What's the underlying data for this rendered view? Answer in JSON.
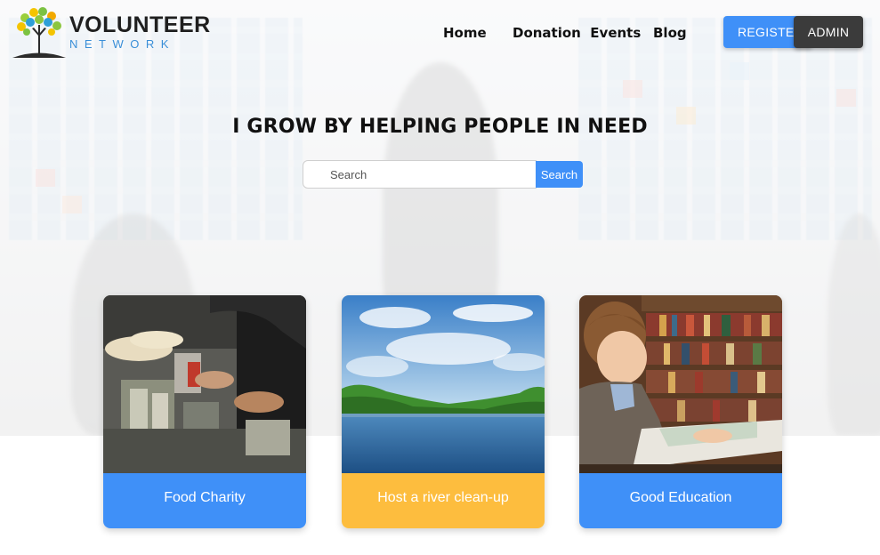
{
  "brand": {
    "name": "VOLUNTEER",
    "tagline": "NETWORK",
    "logo_icon": "tree-icon"
  },
  "nav": {
    "home": "Home",
    "donation_events": "Donation  Events",
    "blog": "Blog"
  },
  "buttons": {
    "register": "REGISTER",
    "admin": "ADMIN"
  },
  "hero": {
    "headline": "I GROW BY HELPING PEOPLE IN NEED",
    "search_placeholder": "Search",
    "search_button": "Search"
  },
  "cards": [
    {
      "title": "Food Charity",
      "image": "food-charity-image",
      "color": "#3f90f8"
    },
    {
      "title": "Host a river clean-up",
      "image": "river-image",
      "color": "#fdbd3e"
    },
    {
      "title": "Good Education",
      "image": "boy-reading-image",
      "color": "#3f90f8"
    }
  ],
  "colors": {
    "primary": "#3f90f8",
    "dark": "#3b3b3b",
    "accent": "#fdbd3e"
  }
}
